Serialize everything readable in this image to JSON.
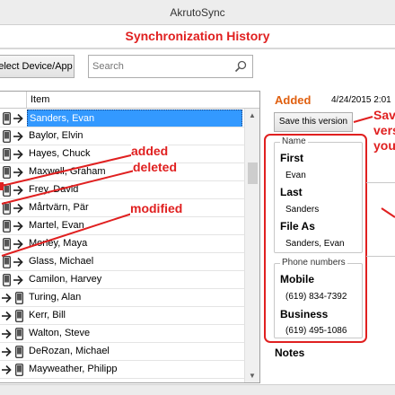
{
  "window": {
    "title": "AkrutoSync"
  },
  "header": {
    "title": "Synchronization History"
  },
  "toolbar": {
    "select_label": "elect Device/App",
    "search_placeholder": "Search"
  },
  "list": {
    "column_item": "Item",
    "rows": [
      {
        "name": "Sanders, Evan",
        "selected": true,
        "direction": "to-device"
      },
      {
        "name": "Baylor, Elvin",
        "direction": "to-device"
      },
      {
        "name": "Hayes, Chuck",
        "direction": "to-device"
      },
      {
        "name": "Maxwell, Graham",
        "direction": "to-device"
      },
      {
        "name": "Frey, David",
        "direction": "to-device"
      },
      {
        "name": "Mårtvärn, Pär",
        "direction": "to-device"
      },
      {
        "name": "Martel, Evan",
        "direction": "to-device"
      },
      {
        "name": "Morley, Maya",
        "direction": "to-device"
      },
      {
        "name": "Glass, Michael",
        "direction": "to-device"
      },
      {
        "name": "Camilon, Harvey",
        "direction": "to-device"
      },
      {
        "name": "Turing, Alan",
        "direction": "to-app"
      },
      {
        "name": "Kerr, Bill",
        "direction": "to-app"
      },
      {
        "name": "Walton, Steve",
        "direction": "to-app"
      },
      {
        "name": "DeRozan, Michael",
        "direction": "to-app"
      },
      {
        "name": "Mayweather, Philipp",
        "direction": "to-app"
      }
    ]
  },
  "annotations": {
    "added": "added",
    "deleted": "deleted",
    "modified": "modified",
    "side_lines": [
      "Sav",
      "vers",
      "you"
    ],
    "color": "#e02020"
  },
  "detail": {
    "status": "Added",
    "date": "4/24/2015 2:01",
    "save_label": "Save this version",
    "name_group": "Name",
    "first_label": "First",
    "first_value": "Evan",
    "last_label": "Last",
    "last_value": "Sanders",
    "fileas_label": "File As",
    "fileas_value": "Sanders, Evan",
    "phone_group": "Phone numbers",
    "mobile_label": "Mobile",
    "mobile_value": "(619) 834-7392",
    "business_label": "Business",
    "business_value": "(619) 495-1086",
    "notes_label": "Notes"
  },
  "colors": {
    "selection": "#3399ff",
    "accent_red": "#e02020",
    "added_orange": "#e06010"
  }
}
